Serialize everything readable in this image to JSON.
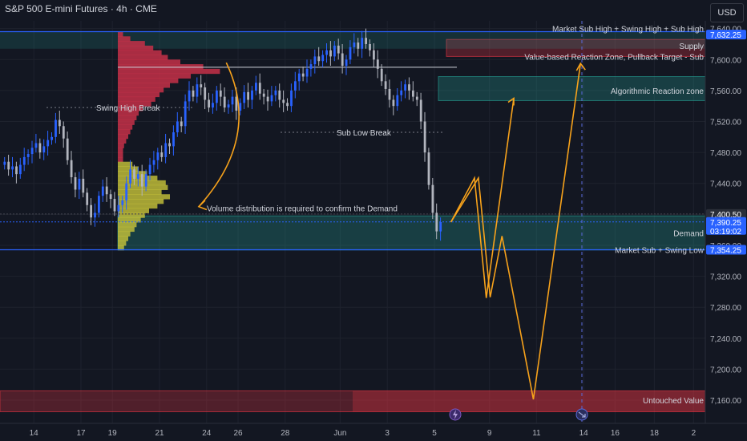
{
  "header": {
    "title": "S&P 500 E-mini Futures · 4h · CME",
    "currency": "USD"
  },
  "colors": {
    "up": "#2962ff",
    "down": "#b2b5be",
    "zone_teal": "#26a69a",
    "zone_red": "#f23645",
    "arrow": "#f7a21b",
    "blue_line": "#2962ff",
    "vol_red": "#c43048",
    "vol_yellow": "#c8c43a"
  },
  "chart_data": {
    "type": "candlestick",
    "timeframe": "4h",
    "ylim": [
      7130,
      7650
    ],
    "y_ticks": [
      7160,
      7200,
      7240,
      7280,
      7320,
      7360,
      7400,
      7440,
      7480,
      7520,
      7560,
      7600,
      7640
    ],
    "y_tick_labels": [
      "7,160.00",
      "7,200.00",
      "7,240.00",
      "7,280.00",
      "7,320.00",
      "7,360.00",
      "7,400.00",
      "7,440.00",
      "7,480.00",
      "7,520.00",
      "7,560.00",
      "7,600.00",
      "7,640.00"
    ],
    "x_ticks": [
      {
        "label": "14",
        "bar": 8
      },
      {
        "label": "17",
        "bar": 20
      },
      {
        "label": "19",
        "bar": 28
      },
      {
        "label": "21",
        "bar": 40
      },
      {
        "label": "24",
        "bar": 52
      },
      {
        "label": "26",
        "bar": 60
      },
      {
        "label": "28",
        "bar": 72
      },
      {
        "label": "Jun",
        "bar": 86
      },
      {
        "label": "3",
        "bar": 98
      },
      {
        "label": "5",
        "bar": 110
      },
      {
        "label": "9",
        "bar": 124
      },
      {
        "label": "11",
        "bar": 136
      },
      {
        "label": "14",
        "bar": 148
      },
      {
        "label": "16",
        "bar": 156
      },
      {
        "label": "18",
        "bar": 166
      },
      {
        "label": "2",
        "bar": 176
      }
    ],
    "total_bars": 180,
    "closes": [
      7468,
      7458,
      7462,
      7452,
      7464,
      7474,
      7478,
      7486,
      7492,
      7480,
      7488,
      7496,
      7500,
      7522,
      7514,
      7498,
      7470,
      7448,
      7432,
      7446,
      7428,
      7412,
      7396,
      7402,
      7424,
      7436,
      7426,
      7420,
      7404,
      7412,
      7418,
      7440,
      7458,
      7446,
      7452,
      7436,
      7452,
      7464,
      7470,
      7480,
      7474,
      7492,
      7488,
      7506,
      7520,
      7514,
      7546,
      7560,
      7552,
      7568,
      7564,
      7548,
      7538,
      7544,
      7560,
      7552,
      7538,
      7542,
      7552,
      7534,
      7544,
      7558,
      7548,
      7560,
      7570,
      7556,
      7552,
      7546,
      7554,
      7560,
      7548,
      7544,
      7540,
      7560,
      7572,
      7582,
      7578,
      7588,
      7594,
      7604,
      7598,
      7606,
      7612,
      7604,
      7618,
      7608,
      7592,
      7600,
      7616,
      7622,
      7614,
      7628,
      7620,
      7612,
      7600,
      7588,
      7572,
      7562,
      7548,
      7540,
      7554,
      7560,
      7568,
      7560,
      7552,
      7548,
      7520,
      7480,
      7438,
      7402,
      7378,
      7390
    ],
    "current_bar": 111,
    "series": [
      {
        "name": "Market Sub High + Swing High + Sub High",
        "value": 7632.25,
        "label": "7,632.25",
        "tag": "blue"
      },
      {
        "name": "",
        "value": 7400.5,
        "label": "7,400.50",
        "tag": "dark"
      },
      {
        "name": "",
        "value": 7390.25,
        "label": "7,390.25",
        "tag": "blue",
        "extra": "03:19:02"
      },
      {
        "name": "Market Sub + Swing Low",
        "value": 7354.25,
        "label": "7,354.25",
        "tag": "blue"
      }
    ],
    "annotations": [
      {
        "text": "Swing High Break",
        "y": 7538
      },
      {
        "text": "Sub Low Break",
        "y": 7506
      },
      {
        "text": "Volume distribution is required to confirm the Demand",
        "y": 7408
      },
      {
        "text": "Supply",
        "y": 7618
      },
      {
        "text": "Value-based Reaction Zone, Pullback Target - Sub",
        "y": 7604
      },
      {
        "text": "Algorithmic Reaction zone",
        "y": 7560
      },
      {
        "text": "Demand",
        "y": 7376
      },
      {
        "text": "Untouched Value",
        "y": 7160
      }
    ],
    "zones": [
      {
        "name": "Supply",
        "from": 7604,
        "to": 7626
      },
      {
        "name": "Algorithmic Reaction zone",
        "from": 7547,
        "to": 7578
      },
      {
        "name": "Demand",
        "from": 7354,
        "to": 7398
      },
      {
        "name": "Untouched Value",
        "from": 7145,
        "to": 7172
      }
    ],
    "projection_path": [
      [
        114,
        7390
      ],
      [
        121,
        7447
      ],
      [
        124,
        7293
      ],
      [
        127,
        7372
      ],
      [
        135,
        7161
      ],
      [
        147,
        7595
      ]
    ],
    "projection_arrow2": [
      [
        114,
        7390
      ],
      [
        120,
        7447
      ],
      [
        123,
        7292
      ],
      [
        130,
        7550
      ]
    ]
  }
}
